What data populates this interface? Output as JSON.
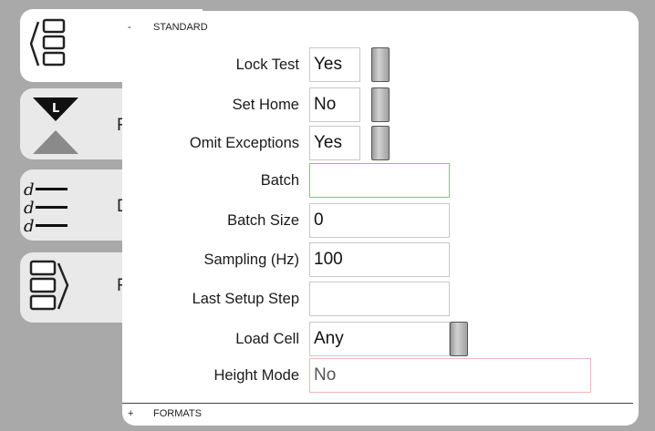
{
  "side_tabs": [
    {
      "icon": "sections-collapse-icon",
      "letter": ""
    },
    {
      "icon": "hourglass-l-icon",
      "letter": "F"
    },
    {
      "icon": "list-d-icon",
      "letter": "D"
    },
    {
      "icon": "sections-expand-icon",
      "letter": "F"
    }
  ],
  "standard": {
    "toggle": "-",
    "title": "STANDARD",
    "fields": {
      "lock_test": {
        "label": "Lock Test",
        "value": "Yes"
      },
      "set_home": {
        "label": "Set Home",
        "value": "No"
      },
      "omit_exceptions": {
        "label": "Omit Exceptions",
        "value": "Yes"
      },
      "batch": {
        "label": "Batch",
        "value": ""
      },
      "batch_size": {
        "label": "Batch Size",
        "value": "0"
      },
      "sampling": {
        "label": "Sampling (Hz)",
        "value": "100"
      },
      "last_setup_step": {
        "label": "Last Setup Step",
        "value": ""
      },
      "load_cell": {
        "label": "Load Cell",
        "value": "Any"
      },
      "height_mode": {
        "label": "Height Mode",
        "value": "No"
      }
    }
  },
  "formats": {
    "toggle": "+",
    "title": "FORMATS"
  },
  "colors": {
    "background": "#a9a9a9",
    "focus_border": "#8fbf7f",
    "readonly_border": "#f0b8b8"
  }
}
